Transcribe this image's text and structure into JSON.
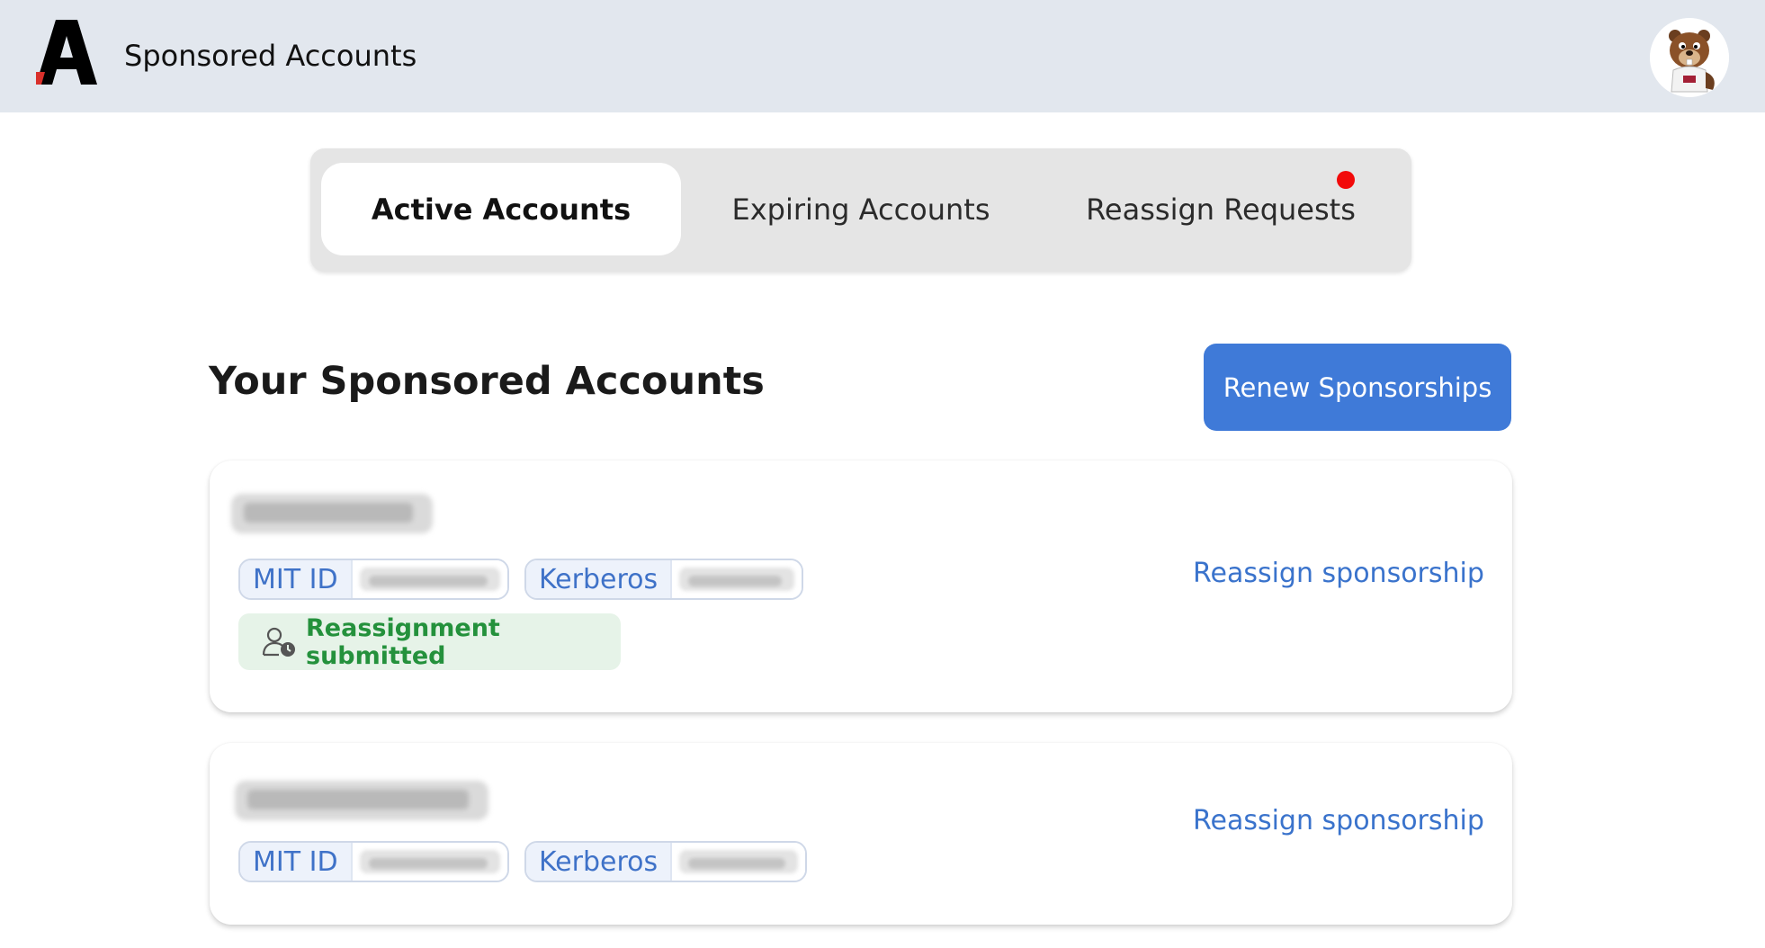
{
  "header": {
    "app_title": "Sponsored Accounts",
    "logo_icon": "a-letter-logo-icon",
    "avatar_icon": "beaver-mascot-avatar-icon"
  },
  "tabs": [
    {
      "label": "Active Accounts",
      "active": true
    },
    {
      "label": "Expiring Accounts",
      "active": false
    },
    {
      "label": "Reassign Requests",
      "active": false,
      "has_notification": true
    }
  ],
  "main": {
    "section_title": "Your Sponsored Accounts",
    "renew_button_label": "Renew Sponsorships"
  },
  "accounts": [
    {
      "mit_id_label": "MIT ID",
      "kerberos_label": "Kerberos",
      "status": "Reassignment submitted",
      "status_icon": "user-clock-icon",
      "action_label": "Reassign sponsorship"
    },
    {
      "mit_id_label": "MIT ID",
      "kerberos_label": "Kerberos",
      "action_label": "Reassign sponsorship"
    }
  ],
  "colors": {
    "header_bg": "#e2e7ee",
    "accent": "#3f7ad8",
    "link": "#3a73cc",
    "success": "#24913c",
    "notification": "#f20a0a"
  }
}
